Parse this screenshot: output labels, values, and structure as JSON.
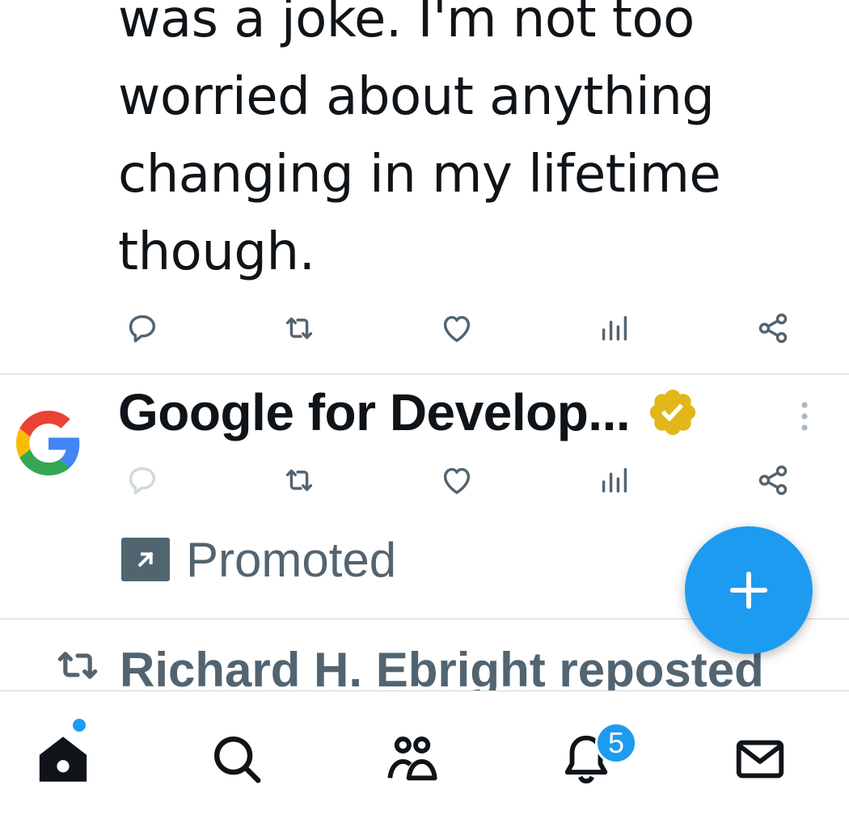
{
  "tweet1": {
    "text": "was a joke. I'm not too\nworried about anything\nchanging in my lifetime\nthough.",
    "actions": [
      "reply-icon",
      "repost-icon",
      "like-icon",
      "views-icon",
      "share-icon"
    ]
  },
  "ad_tweet": {
    "author_name": "Google for Develop...",
    "verified_badge": "gold-verified-icon",
    "avatar": "google-logo",
    "promoted_label": "Promoted",
    "actions": [
      "reply-icon",
      "repost-icon",
      "like-icon",
      "views-icon",
      "share-icon"
    ]
  },
  "repost_notice": {
    "text": "Richard H. Ebright reposted"
  },
  "fab": {
    "icon": "plus-icon"
  },
  "bottom_nav": {
    "items": [
      "home-icon",
      "search-icon",
      "communities-icon",
      "notifications-icon",
      "messages-icon"
    ],
    "notifications_badge": "5"
  },
  "colors": {
    "accent": "#1d9bf0",
    "text_primary": "#0f1419",
    "text_secondary": "#536471",
    "divider": "#cfd9de",
    "verified_gold": "#e2b719"
  }
}
